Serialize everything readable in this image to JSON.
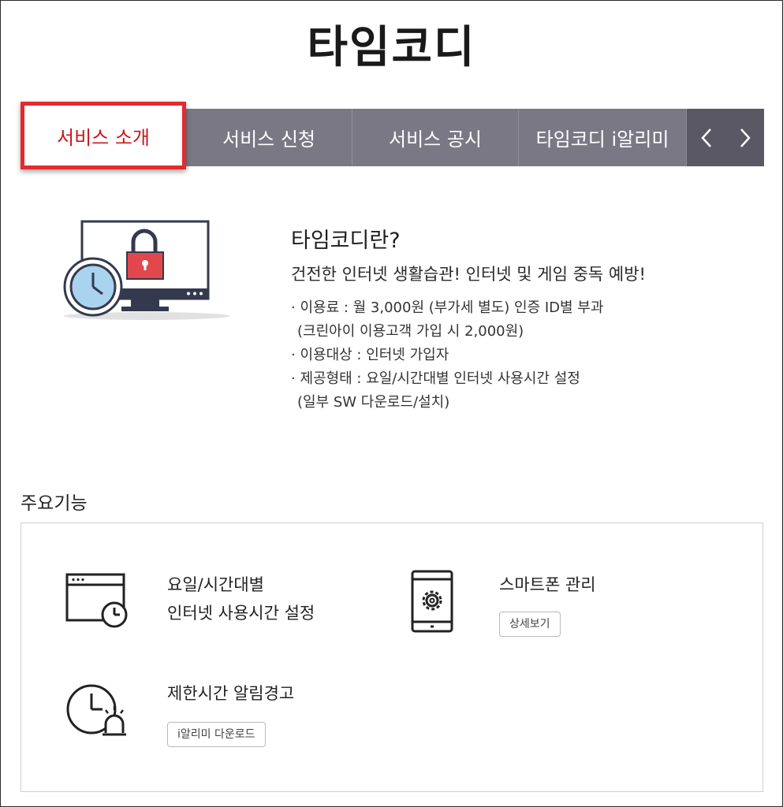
{
  "page": {
    "title": "타임코디"
  },
  "tabs": [
    {
      "label": "서비스 소개",
      "active": true
    },
    {
      "label": "서비스 신청",
      "active": false
    },
    {
      "label": "서비스 공시",
      "active": false
    },
    {
      "label": "타임코디 i알리미",
      "active": false
    }
  ],
  "tab_nav": {
    "prev_icon": "chevron-left-icon",
    "next_icon": "chevron-right-icon"
  },
  "intro": {
    "title": "타임코디란?",
    "subtitle": "건전한 인터넷 생활습관! 인터넷 및 게임 중독 예방!",
    "lines": [
      "· 이용료 : 월 3,000원 (부가세 별도) 인증 ID별 부과",
      "(크린아이 이용고객 가입 시 2,000원)",
      "· 이용대상 : 인터넷 가입자",
      "· 제공형태 : 요일/시간대별 인터넷 사용시간 설정",
      "(일부 SW 다운로드/설치)"
    ]
  },
  "features_section": {
    "title": "주요기능",
    "items": [
      {
        "icon": "browser-clock-icon",
        "line1": "요일/시간대별",
        "line2": "인터넷 사용시간 설정"
      },
      {
        "icon": "smartphone-gear-icon",
        "line1": "스마트폰 관리",
        "button": "상세보기"
      },
      {
        "icon": "clock-alarm-icon",
        "line1": "제한시간 알림경고",
        "button": "i알리미 다운로드"
      }
    ]
  },
  "colors": {
    "tab_bg": "#7a7885",
    "tab_active_border": "#e32a2f",
    "tab_active_text": "#c7161e",
    "lock_red": "#e2474d",
    "clock_blue": "#a9d3ef",
    "monitor_dark": "#343a4d"
  }
}
